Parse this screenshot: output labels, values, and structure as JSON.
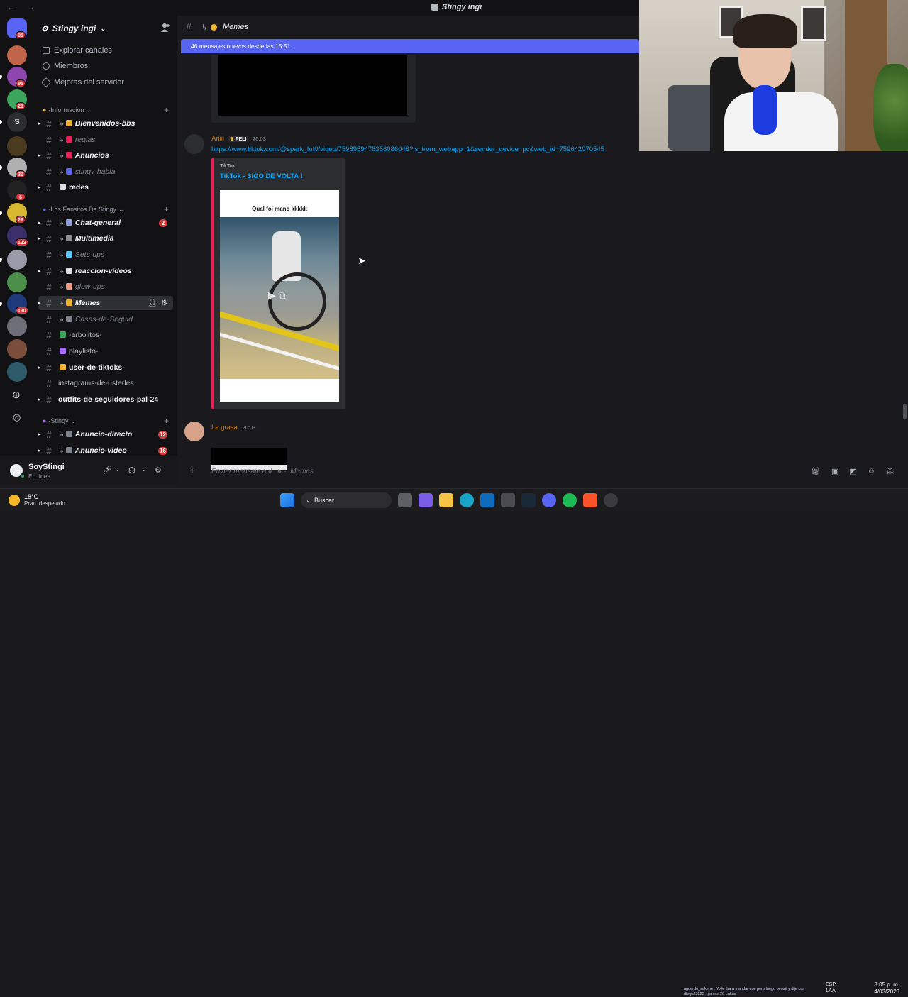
{
  "window": {
    "title": "Stingy ingi"
  },
  "rail": {
    "servers": [
      {
        "name": "direct-messages",
        "badge": "90",
        "color": "#5865f2"
      },
      {
        "name": "server-1",
        "badge": "",
        "color": "#c0644a"
      },
      {
        "name": "server-2",
        "badge": "91",
        "color": "#8e44ad"
      },
      {
        "name": "server-3",
        "badge": "20",
        "color": "#3ba55c"
      },
      {
        "name": "server-4",
        "badge": "",
        "color": "#2b2d31",
        "letter": "S"
      },
      {
        "name": "server-5",
        "badge": "",
        "color": "#4a3a1f"
      },
      {
        "name": "server-6",
        "badge": "30",
        "color": "#b0b0b0"
      },
      {
        "name": "server-7",
        "badge": "6",
        "color": "#222222"
      },
      {
        "name": "server-8",
        "badge": "28",
        "color": "#d8b830"
      },
      {
        "name": "server-9",
        "badge": "122",
        "color": "#3b2f6b"
      },
      {
        "name": "server-10",
        "badge": "",
        "color": "#9a9aa8"
      },
      {
        "name": "server-11",
        "badge": "",
        "color": "#4c8f4a"
      },
      {
        "name": "server-12",
        "badge": "190",
        "color": "#1f3a7a"
      },
      {
        "name": "server-13",
        "badge": "",
        "color": "#6e6e78"
      },
      {
        "name": "server-14",
        "badge": "",
        "color": "#7a4e3a"
      },
      {
        "name": "server-15",
        "badge": "",
        "color": "#2e5a6a"
      }
    ]
  },
  "sidebar": {
    "server_name": "Stingy ingi",
    "nav": [
      "Explorar canales",
      "Miembros",
      "Mejoras del servidor"
    ],
    "categories": {
      "info": "-Información",
      "fans": "-Los Fansitos De Stingy",
      "stingy": "-Stingy"
    },
    "channels": [
      {
        "name": "Bienvenidos-bbs",
        "style": "unread",
        "prefix": "↳",
        "emo": "#f0b232"
      },
      {
        "name": "reglas",
        "style": "muted",
        "prefix": "↳",
        "emo": "#e91f58"
      },
      {
        "name": "Anuncios",
        "style": "unread",
        "prefix": "↳",
        "emo": "#e91f58"
      },
      {
        "name": "stingy-habla",
        "style": "muted",
        "prefix": "↳",
        "emo": "#5865f2"
      },
      {
        "name": "redes",
        "style": "plainbold",
        "prefix": "",
        "emo": "#e0e0e0"
      },
      {
        "name": "Chat-general",
        "style": "unread",
        "prefix": "↳",
        "emo": "#8ea1e1",
        "badge": "2"
      },
      {
        "name": "Multimedia",
        "style": "unread",
        "prefix": "↳",
        "emo": "#8e8e8e"
      },
      {
        "name": "Sets-ups",
        "style": "muted",
        "prefix": "↳",
        "emo": "#5ac8fa"
      },
      {
        "name": "reaccion-videos",
        "style": "unread",
        "prefix": "↳",
        "emo": "#e0e0e0"
      },
      {
        "name": "glow-ups",
        "style": "muted",
        "prefix": "↳",
        "emo": "#f29b84"
      },
      {
        "name": "Memes",
        "style": "active",
        "prefix": "↳",
        "emo": "#f0b232"
      },
      {
        "name": "Casas-de-Seguid",
        "style": "muted",
        "prefix": "↳",
        "emo": "#80848e"
      },
      {
        "name": "-arbolitos-",
        "style": "plain",
        "prefix": "",
        "emo": "#3ba55c"
      },
      {
        "name": "playlisto-",
        "style": "plain",
        "prefix": "",
        "emo": "#a66efa"
      },
      {
        "name": "user-de-tiktoks-",
        "style": "plainbold",
        "prefix": "",
        "emo": "#f0b232"
      },
      {
        "name": "instagrams-de-ustedes",
        "style": "plain",
        "prefix": "",
        "emo": ""
      },
      {
        "name": "outfits-de-seguidores-pal-24",
        "style": "plainbold",
        "prefix": "",
        "emo": ""
      },
      {
        "name": "Anuncio-directo",
        "style": "unread",
        "prefix": "↳",
        "emo": "#80848e",
        "badge": "12"
      },
      {
        "name": "Anuncio-video",
        "style": "unread",
        "prefix": "↳",
        "emo": "#80848e",
        "badge": "16"
      }
    ]
  },
  "user": {
    "name": "SoyStingi",
    "status": "En línea"
  },
  "chat": {
    "channel": "Memes",
    "new_messages": "46 mensajes nuevos desde las 15:51",
    "message1": {
      "author": "Ariiii",
      "tag": "PELI",
      "time": "20:03",
      "link": "https://www.tiktok.com/@spark_fut0/video/7598959478356086048?is_from_webapp=1&sender_device=pc&web_id=759642070545",
      "embed_provider": "TikTok",
      "embed_title": "TikTok - SIGO DE VOLTA !",
      "thumb_caption": "Qual foi mano kkkkk"
    },
    "message2": {
      "author": "La grasa",
      "time": "20:03"
    },
    "composer_placeholder": "Enviar mensaje a #  ↳ ·  Memes"
  },
  "taskbar": {
    "temp": "18°C",
    "condition": "Prac. despejado",
    "search": "Buscar",
    "ticker_line1": "aguerdo_salome : Yo le iba a mandar ese pero luego pensé y dije cuando le daría risa",
    "ticker_line2": "diego23223 : ya van 20 Lukas",
    "lang": "ESP",
    "lang2": "LAA",
    "time": "8:05 p. m.",
    "date": "4/03/2026"
  }
}
